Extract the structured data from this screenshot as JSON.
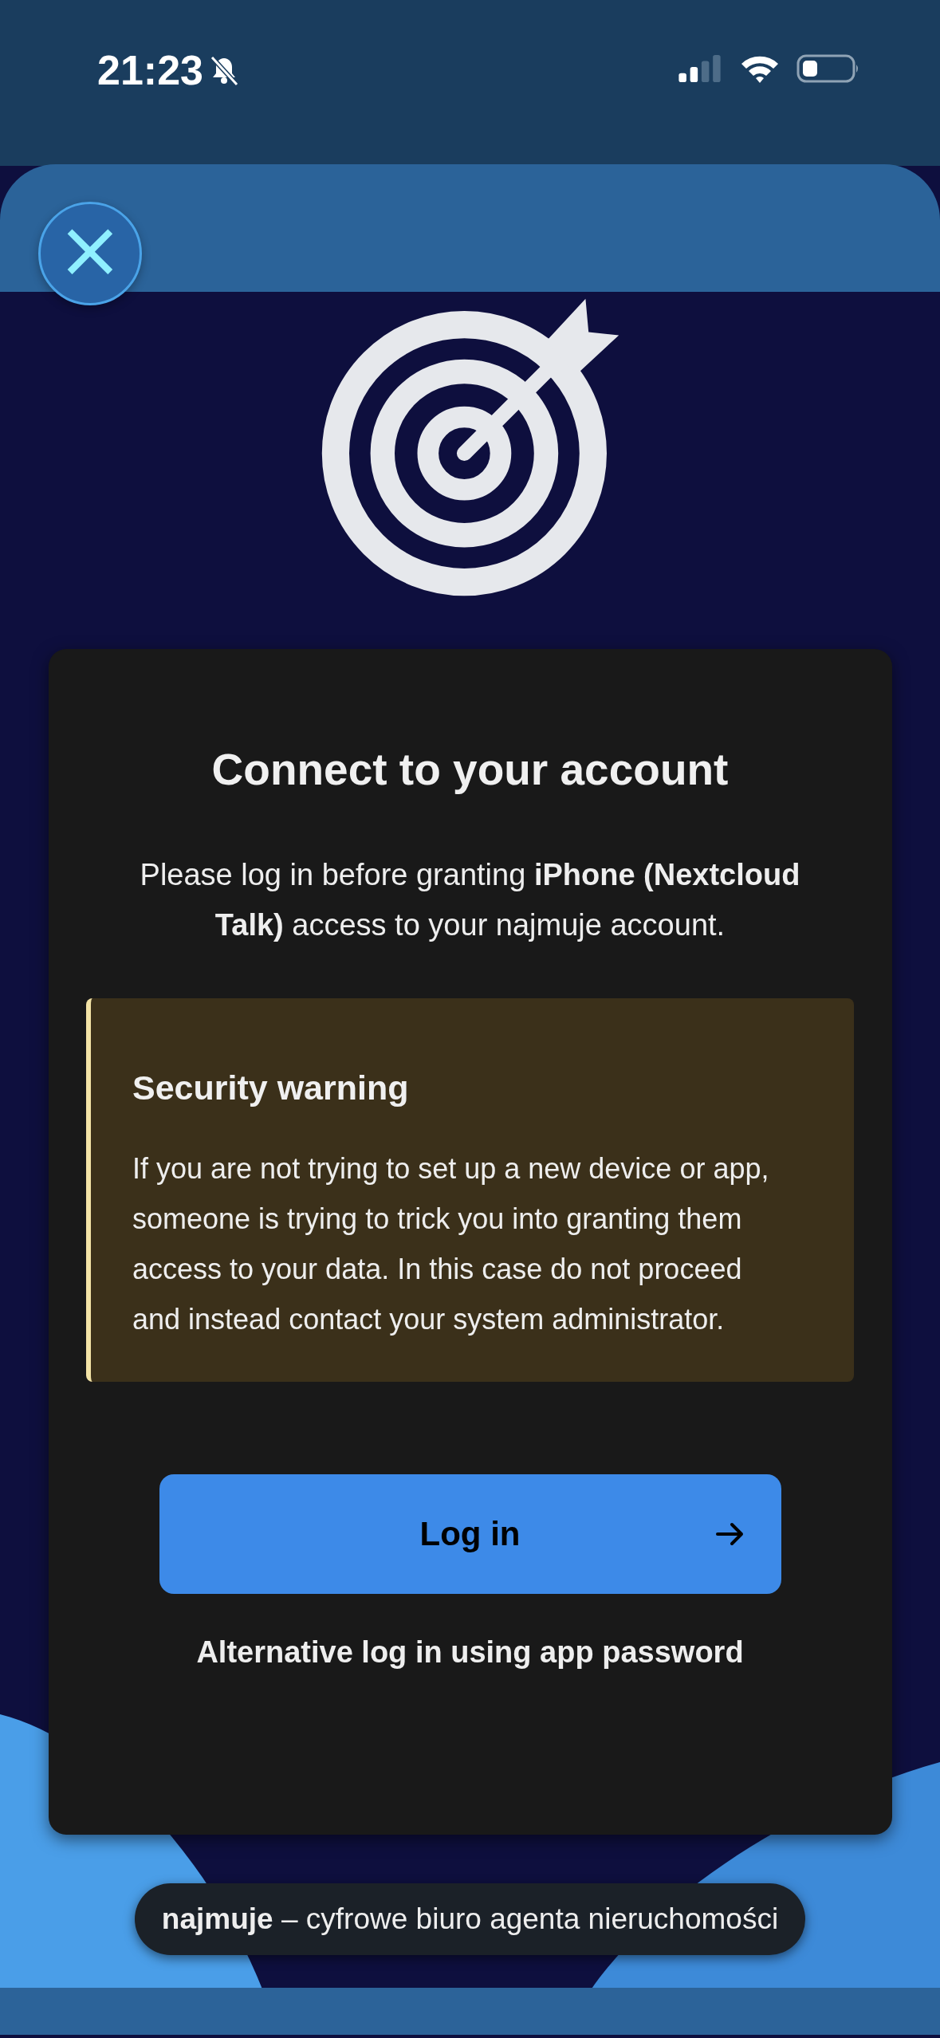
{
  "status_bar": {
    "time": "21:23"
  },
  "close_button": {
    "label": "×"
  },
  "card": {
    "title": "Connect to your account",
    "intro": "Please log in before granting **iPhone (Nextcloud Talk)** access to your najmuje account.",
    "warning": {
      "title": "Security warning",
      "body": "If you are not trying to set up a new device or app, someone is trying to trick you into granting them access to your data. In this case do not proceed and instead contact your system administrator."
    },
    "login_button": {
      "label": "Log in"
    },
    "alternative_link": "Alternative log in using app password"
  },
  "footer": "**najmuje** – cyfrowe biuro agenta nieruchomości"
}
